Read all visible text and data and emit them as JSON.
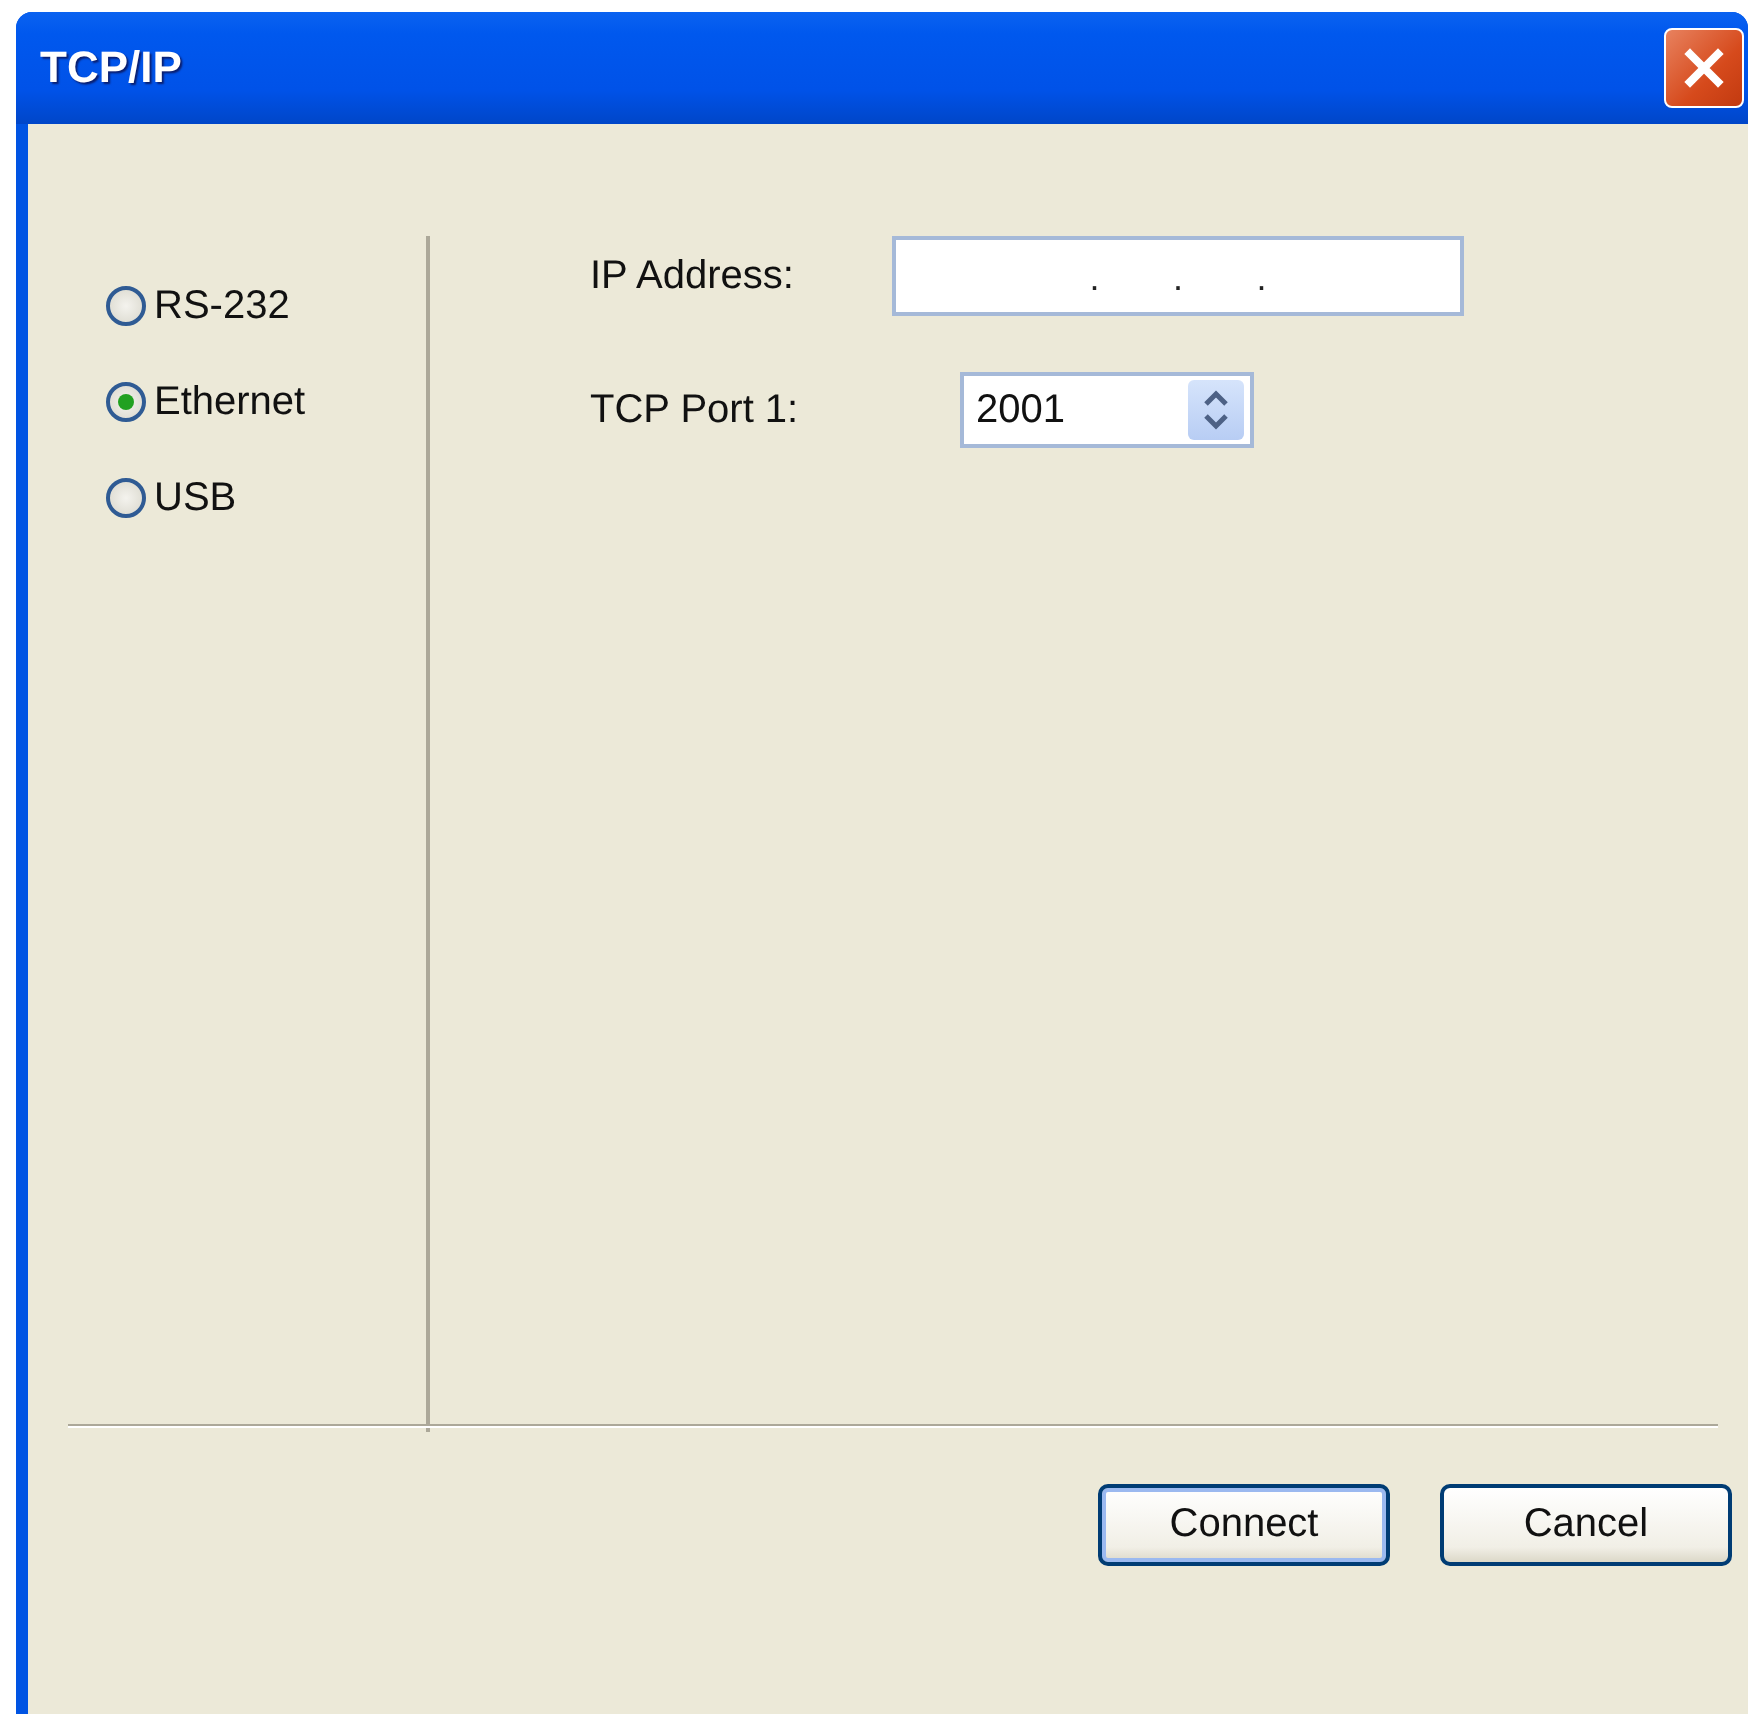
{
  "window": {
    "title": "TCP/IP"
  },
  "connection_types": [
    {
      "label": "RS-232",
      "selected": false
    },
    {
      "label": "Ethernet",
      "selected": true
    },
    {
      "label": "USB",
      "selected": false
    }
  ],
  "ip_address": {
    "label": "IP Address:",
    "separators": [
      ".",
      ".",
      "."
    ]
  },
  "tcp_port": {
    "label": "TCP Port 1:",
    "value": "2001"
  },
  "buttons": [
    {
      "label": "Connect",
      "default": true
    },
    {
      "label": "Cancel",
      "default": false
    }
  ]
}
